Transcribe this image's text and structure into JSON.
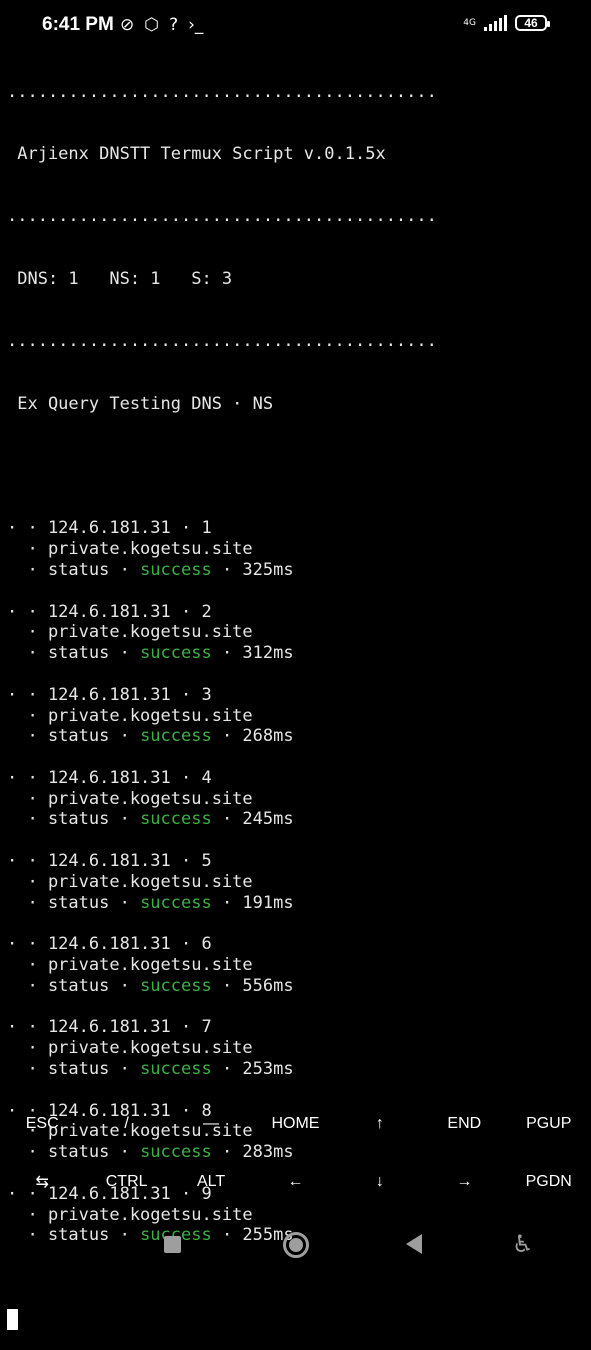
{
  "status_bar": {
    "time": "6:41 PM",
    "icons": [
      "alarm-off-icon",
      "hd-icon",
      "signal-question-icon",
      "terminal-prompt-icon"
    ],
    "network": "4G",
    "battery": "46"
  },
  "terminal": {
    "separator": "..........................................",
    "title": " Arjienx DNSTT Termux Script v.0.1.5x",
    "counts": " DNS: 1   NS: 1   S: 3",
    "testing_line": " Ex Query Testing DNS · NS",
    "results": [
      {
        "line1": "· · 124.6.181.31 · 1",
        "line2": "  · private.kogetsu.site",
        "status_prefix": "  · status · ",
        "status": "success",
        "time_suffix": " · 325ms"
      },
      {
        "line1": "· · 124.6.181.31 · 2",
        "line2": "  · private.kogetsu.site",
        "status_prefix": "  · status · ",
        "status": "success",
        "time_suffix": " · 312ms"
      },
      {
        "line1": "· · 124.6.181.31 · 3",
        "line2": "  · private.kogetsu.site",
        "status_prefix": "  · status · ",
        "status": "success",
        "time_suffix": " · 268ms"
      },
      {
        "line1": "· · 124.6.181.31 · 4",
        "line2": "  · private.kogetsu.site",
        "status_prefix": "  · status · ",
        "status": "success",
        "time_suffix": " · 245ms"
      },
      {
        "line1": "· · 124.6.181.31 · 5",
        "line2": "  · private.kogetsu.site",
        "status_prefix": "  · status · ",
        "status": "success",
        "time_suffix": " · 191ms"
      },
      {
        "line1": "· · 124.6.181.31 · 6",
        "line2": "  · private.kogetsu.site",
        "status_prefix": "  · status · ",
        "status": "success",
        "time_suffix": " · 556ms"
      },
      {
        "line1": "· · 124.6.181.31 · 7",
        "line2": "  · private.kogetsu.site",
        "status_prefix": "  · status · ",
        "status": "success",
        "time_suffix": " · 253ms"
      },
      {
        "line1": "· · 124.6.181.31 · 8",
        "line2": "  · private.kogetsu.site",
        "status_prefix": "  · status · ",
        "status": "success",
        "time_suffix": " · 283ms"
      },
      {
        "line1": "· · 124.6.181.31 · 9",
        "line2": "  · private.kogetsu.site",
        "status_prefix": "  · status · ",
        "status": "success",
        "time_suffix": " · 255ms"
      }
    ]
  },
  "extra_keys": {
    "row1": [
      "ESC",
      "/",
      "—",
      "HOME",
      "↑",
      "END",
      "PGUP"
    ],
    "row2": [
      "⇆",
      "CTRL",
      "ALT",
      "←",
      "↓",
      "→",
      "PGDN"
    ]
  },
  "colors": {
    "background": "#000000",
    "text": "#e6e6e6",
    "success": "#3cb043"
  }
}
